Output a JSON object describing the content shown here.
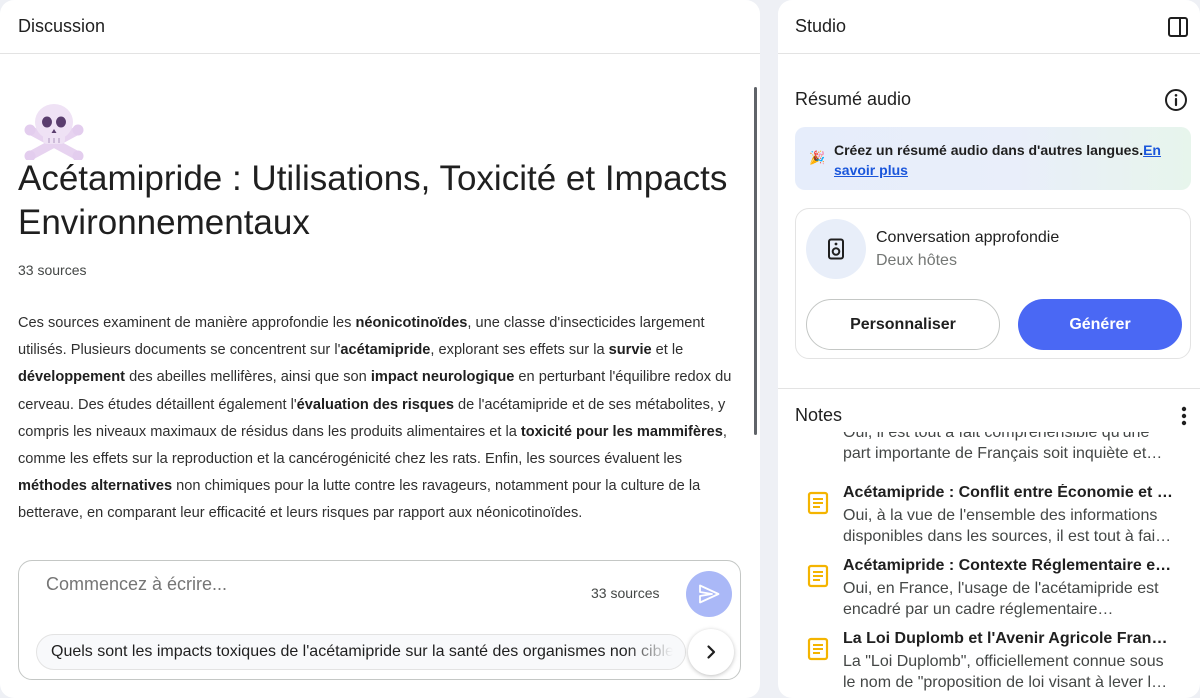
{
  "discussion": {
    "header": "Discussion",
    "emoji": "☠️",
    "title": "Acétamipride : Utilisations, Toxicité et Impacts Environnementaux",
    "source_count": "33 sources",
    "summary": [
      {
        "t": "Ces sources examinent de manière approfondie les ",
        "b": false
      },
      {
        "t": "néonicotinoïdes",
        "b": true
      },
      {
        "t": ", une classe d'insecticides largement utilisés. Plusieurs documents se concentrent sur l'",
        "b": false
      },
      {
        "t": "acétamipride",
        "b": true
      },
      {
        "t": ", explorant ses effets sur la ",
        "b": false
      },
      {
        "t": "survie",
        "b": true
      },
      {
        "t": " et le ",
        "b": false
      },
      {
        "t": "développement",
        "b": true
      },
      {
        "t": " des abeilles mellifères, ainsi que son ",
        "b": false
      },
      {
        "t": "impact neurologique",
        "b": true
      },
      {
        "t": " en perturbant l'équilibre redox du cerveau. Des études détaillent également l'",
        "b": false
      },
      {
        "t": "évaluation des risques",
        "b": true
      },
      {
        "t": " de l'acétamipride et de ses métabolites, y compris les niveaux maximaux de résidus dans les produits alimentaires et la ",
        "b": false
      },
      {
        "t": "toxicité pour les mammifères",
        "b": true
      },
      {
        "t": ", comme les effets sur la reproduction et la cancérogénicité chez les rats. Enfin, les sources évaluent les ",
        "b": false
      },
      {
        "t": "méthodes alternatives",
        "b": true
      },
      {
        "t": " non chimiques pour la lutte contre les ravageurs, notamment pour la culture de la betterave, en comparant leur efficacité et leurs risques par rapport aux néonicotinoïdes.",
        "b": false
      }
    ],
    "composer": {
      "placeholder": "Commencez à écrire...",
      "source_count": "33 sources",
      "suggestion": "Quels sont les impacts toxiques de l'acétamipride sur la santé des organismes non cibles ?"
    }
  },
  "studio": {
    "header": "Studio",
    "audio_section_title": "Résumé audio",
    "promo": {
      "text": "Créez un résumé audio dans d'autres langues.",
      "link": "En savoir plus"
    },
    "audio_card": {
      "title": "Conversation approfondie",
      "subtitle": "Deux hôtes",
      "customize_label": "Personnaliser",
      "generate_label": "Générer"
    },
    "notes_title": "Notes",
    "notes_partial_text": "Oui, il est tout à fait compréhensible qu'une part importante de Français soit inquiète et…",
    "notes": [
      {
        "title": "Acétamipride : Conflit entre Économie et Santé",
        "body": "Oui, à la vue de l'ensemble des informations disponibles dans les sources, il est tout à fait compréhensible…"
      },
      {
        "title": "Acétamipride : Contexte Réglementaire et Enjeux",
        "body": "Oui, en France, l'usage de l'acétamipride est encadré par un cadre réglementaire complexe…"
      },
      {
        "title": "La Loi Duplomb et l'Avenir Agricole Français",
        "body": "La \"Loi Duplomb\", officiellement connue sous le nom de \"proposition de loi visant à lever les contraintes…"
      }
    ]
  },
  "colors": {
    "accent": "#4a68f4",
    "send_disabled": "#aab8f7",
    "note_icon": "#f4b400",
    "link": "#1a56db"
  },
  "icons": {
    "panel_toggle": "side-panel-icon",
    "info": "info-icon",
    "audio": "speaker-icon",
    "send": "send-icon",
    "next": "chevron-right-icon",
    "menu": "more-vert-icon",
    "note": "note-icon",
    "promo": "party-popper-icon"
  }
}
